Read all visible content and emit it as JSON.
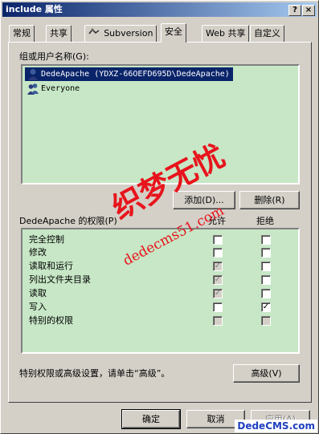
{
  "window": {
    "title": "include 属性",
    "help_btn": "?",
    "close_btn": "×"
  },
  "tabs": [
    {
      "label": "常规"
    },
    {
      "label": "共享"
    },
    {
      "label": "Subversion",
      "icon": "subversion-icon"
    },
    {
      "label": "安全",
      "active": true
    },
    {
      "label": "Web 共享"
    },
    {
      "label": "自定义"
    }
  ],
  "security": {
    "group_label": "组或用户名称(G):",
    "users": [
      {
        "name": "DedeApache (YDXZ-66OEFD695D\\DedeApache)",
        "selected": true,
        "icon": "user-icon"
      },
      {
        "name": "Everyone",
        "selected": false,
        "icon": "group-icon"
      }
    ],
    "add_button": "添加(D)...",
    "remove_button": "删除(R)",
    "perm_label": "DedeApache 的权限(P)",
    "allow_header": "允许",
    "deny_header": "拒绝",
    "permissions": [
      {
        "name": "完全控制",
        "allow": "unchecked",
        "deny": "unchecked"
      },
      {
        "name": "修改",
        "allow": "unchecked",
        "deny": "unchecked"
      },
      {
        "name": "读取和运行",
        "allow": "checked-disabled",
        "deny": "unchecked"
      },
      {
        "name": "列出文件夹目录",
        "allow": "checked-disabled",
        "deny": "unchecked"
      },
      {
        "name": "读取",
        "allow": "checked-disabled",
        "deny": "unchecked"
      },
      {
        "name": "写入",
        "allow": "unchecked",
        "deny": "checked"
      },
      {
        "name": "特别的权限",
        "allow": "unchecked-disabled",
        "deny": "unchecked-disabled"
      }
    ],
    "special_note": "特别权限或高级设置，请单击“高级”。",
    "advanced_button": "高级(V)"
  },
  "footer": {
    "ok": "确定",
    "cancel": "取消",
    "apply": "应用(A)"
  },
  "watermark": {
    "text": "织梦无忧",
    "url": "dedecms51.com",
    "corner": "DedeCMS.com"
  }
}
